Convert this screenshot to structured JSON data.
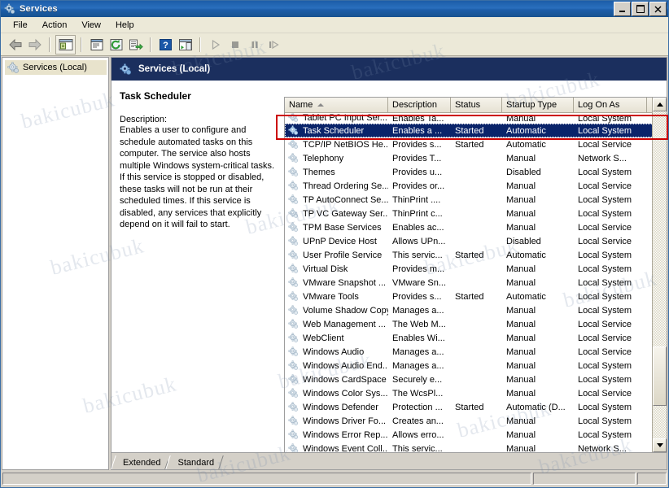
{
  "window": {
    "title": "Services",
    "icon": "services-gear-icon",
    "controls": {
      "minimize": "_",
      "maximize": "□",
      "close": "✕"
    }
  },
  "menubar": {
    "items": [
      "File",
      "Action",
      "View",
      "Help"
    ]
  },
  "toolbar": {
    "buttons": [
      {
        "name": "back-icon",
        "label": "Back",
        "enabled": true
      },
      {
        "name": "forward-icon",
        "label": "Forward",
        "enabled": false
      },
      {
        "name": "show-hide-tree-icon",
        "label": "Show/Hide Console Tree",
        "enabled": true
      },
      {
        "name": "properties-icon",
        "label": "Properties",
        "enabled": true
      },
      {
        "name": "refresh-icon",
        "label": "Refresh",
        "enabled": true
      },
      {
        "name": "export-list-icon",
        "label": "Export List",
        "enabled": true
      },
      {
        "name": "help-icon",
        "label": "Help",
        "enabled": true
      },
      {
        "name": "show-action-pane-icon",
        "label": "Show/Hide Action Pane",
        "enabled": true
      },
      {
        "name": "start-service-icon",
        "label": "Start Service",
        "enabled": false
      },
      {
        "name": "stop-service-icon",
        "label": "Stop Service",
        "enabled": false
      },
      {
        "name": "pause-service-icon",
        "label": "Pause Service",
        "enabled": false
      },
      {
        "name": "restart-service-icon",
        "label": "Restart Service",
        "enabled": false
      }
    ]
  },
  "tree": {
    "items": [
      {
        "label": "Services (Local)",
        "icon": "services-gear-icon",
        "selected": true
      }
    ]
  },
  "banner": {
    "title": "Services (Local)",
    "icon": "services-gear-icon"
  },
  "details": {
    "service_name": "Task Scheduler",
    "description_label": "Description:",
    "description": "Enables a user to configure and schedule automated tasks on this computer. The service also hosts multiple Windows system-critical tasks. If this service is stopped or disabled, these tasks will not be run at their scheduled times. If this service is disabled, any services that explicitly depend on it will fail to start."
  },
  "list": {
    "columns": [
      {
        "label": "Name",
        "sorted": "asc"
      },
      {
        "label": "Description",
        "sorted": ""
      },
      {
        "label": "Status",
        "sorted": ""
      },
      {
        "label": "Startup Type",
        "sorted": ""
      },
      {
        "label": "Log On As",
        "sorted": ""
      }
    ],
    "rows": [
      {
        "name": "Tablet PC Input Ser...",
        "description": "Enables Ta...",
        "status": "",
        "startup": "Manual",
        "logon": "Local System",
        "selected": false,
        "clipped": true
      },
      {
        "name": "Task Scheduler",
        "description": "Enables a ...",
        "status": "Started",
        "startup": "Automatic",
        "logon": "Local System",
        "selected": true
      },
      {
        "name": "TCP/IP NetBIOS He...",
        "description": "Provides s...",
        "status": "Started",
        "startup": "Automatic",
        "logon": "Local Service",
        "selected": false
      },
      {
        "name": "Telephony",
        "description": "Provides T...",
        "status": "",
        "startup": "Manual",
        "logon": "Network S...",
        "selected": false
      },
      {
        "name": "Themes",
        "description": "Provides u...",
        "status": "",
        "startup": "Disabled",
        "logon": "Local System",
        "selected": false
      },
      {
        "name": "Thread Ordering Se...",
        "description": "Provides or...",
        "status": "",
        "startup": "Manual",
        "logon": "Local Service",
        "selected": false
      },
      {
        "name": "TP AutoConnect Se...",
        "description": "ThinPrint ....",
        "status": "",
        "startup": "Manual",
        "logon": "Local System",
        "selected": false
      },
      {
        "name": "TP VC Gateway Ser...",
        "description": "ThinPrint c...",
        "status": "",
        "startup": "Manual",
        "logon": "Local System",
        "selected": false
      },
      {
        "name": "TPM Base Services",
        "description": "Enables ac...",
        "status": "",
        "startup": "Manual",
        "logon": "Local Service",
        "selected": false
      },
      {
        "name": "UPnP Device Host",
        "description": "Allows UPn...",
        "status": "",
        "startup": "Disabled",
        "logon": "Local Service",
        "selected": false
      },
      {
        "name": "User Profile Service",
        "description": "This servic...",
        "status": "Started",
        "startup": "Automatic",
        "logon": "Local System",
        "selected": false
      },
      {
        "name": "Virtual Disk",
        "description": "Provides m...",
        "status": "",
        "startup": "Manual",
        "logon": "Local System",
        "selected": false
      },
      {
        "name": "VMware Snapshot ...",
        "description": "VMware Sn...",
        "status": "",
        "startup": "Manual",
        "logon": "Local System",
        "selected": false
      },
      {
        "name": "VMware Tools",
        "description": "Provides s...",
        "status": "Started",
        "startup": "Automatic",
        "logon": "Local System",
        "selected": false
      },
      {
        "name": "Volume Shadow Copy",
        "description": "Manages a...",
        "status": "",
        "startup": "Manual",
        "logon": "Local System",
        "selected": false
      },
      {
        "name": "Web Management ...",
        "description": "The Web M...",
        "status": "",
        "startup": "Manual",
        "logon": "Local Service",
        "selected": false
      },
      {
        "name": "WebClient",
        "description": "Enables Wi...",
        "status": "",
        "startup": "Manual",
        "logon": "Local Service",
        "selected": false
      },
      {
        "name": "Windows Audio",
        "description": "Manages a...",
        "status": "",
        "startup": "Manual",
        "logon": "Local Service",
        "selected": false
      },
      {
        "name": "Windows Audio End...",
        "description": "Manages a...",
        "status": "",
        "startup": "Manual",
        "logon": "Local System",
        "selected": false
      },
      {
        "name": "Windows CardSpace",
        "description": "Securely e...",
        "status": "",
        "startup": "Manual",
        "logon": "Local System",
        "selected": false
      },
      {
        "name": "Windows Color Sys...",
        "description": "The WcsPl...",
        "status": "",
        "startup": "Manual",
        "logon": "Local Service",
        "selected": false
      },
      {
        "name": "Windows Defender",
        "description": "Protection ...",
        "status": "Started",
        "startup": "Automatic (D...",
        "logon": "Local System",
        "selected": false
      },
      {
        "name": "Windows Driver Fo...",
        "description": "Creates an...",
        "status": "",
        "startup": "Manual",
        "logon": "Local System",
        "selected": false
      },
      {
        "name": "Windows Error Rep...",
        "description": "Allows erro...",
        "status": "",
        "startup": "Manual",
        "logon": "Local System",
        "selected": false
      },
      {
        "name": "Windows Event Coll...",
        "description": "This servic...",
        "status": "",
        "startup": "Manual",
        "logon": "Network S...",
        "selected": false
      }
    ]
  },
  "tabs": [
    {
      "label": "Extended",
      "active": false
    },
    {
      "label": "Standard",
      "active": true
    }
  ],
  "statusbar": {
    "panes": [
      "",
      "",
      ""
    ]
  },
  "annotation": {
    "color": "#cc0000",
    "target_row": "Task Scheduler"
  },
  "watermark": {
    "text": "bakicubuk"
  },
  "colors": {
    "titlebar": "#1d5ea9",
    "banner": "#1b2f5e",
    "selection": "#0a246a",
    "chrome": "#d4d0c8",
    "menu": "#ece9d8",
    "annotation": "#cc0000"
  }
}
